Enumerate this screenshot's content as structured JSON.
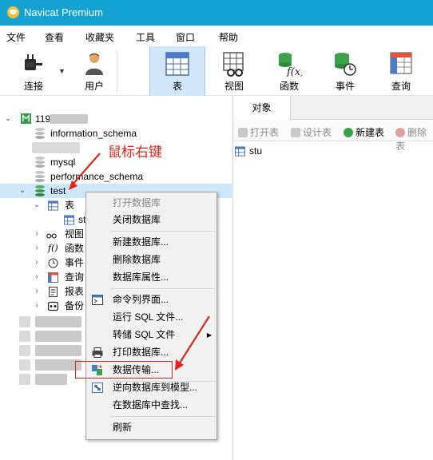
{
  "window": {
    "title": "Navicat Premium"
  },
  "menu": [
    "文件",
    "查看",
    "收藏夹",
    "工具",
    "窗口",
    "帮助"
  ],
  "toolbar": {
    "connect": "连接",
    "user": "用户",
    "table": "表",
    "view": "视图",
    "function": "函数",
    "event": "事件",
    "query": "查询"
  },
  "tree": {
    "connection": "119.",
    "dbs": [
      "information_schema",
      "mysql",
      "performance_schema",
      "test"
    ],
    "test_children": {
      "table_group": "表",
      "table_item": "st",
      "view_group": "视图",
      "function_group": "函数",
      "event_group": "事件",
      "query_group": "查询",
      "report_group": "报表",
      "backup_group": "备份"
    }
  },
  "right": {
    "tab": "对象",
    "actions": [
      "打开表",
      "设计表",
      "新建表",
      "删除表"
    ],
    "objects": [
      "stu"
    ]
  },
  "context_menu": {
    "items": [
      {
        "label": "打开数据库",
        "enabled": false
      },
      {
        "label": "关闭数据库",
        "enabled": true
      },
      {
        "label": "新建数据库...",
        "enabled": true
      },
      {
        "label": "删除数据库",
        "enabled": true
      },
      {
        "label": "数据库属性...",
        "enabled": true
      },
      {
        "label": "命令列界面...",
        "enabled": true
      },
      {
        "label": "运行 SQL 文件...",
        "enabled": true
      },
      {
        "label": "转储 SQL 文件",
        "enabled": true
      },
      {
        "label": "打印数据库...",
        "enabled": true
      },
      {
        "label": "数据传输...",
        "enabled": true
      },
      {
        "label": "逆向数据库到模型...",
        "enabled": true
      },
      {
        "label": "在数据库中查找...",
        "enabled": true
      },
      {
        "label": "刷新",
        "enabled": true
      }
    ]
  },
  "annotation": {
    "text": "鼠标右键"
  },
  "colors": {
    "titlebar": "#13a2d2",
    "selection": "#cde8fb",
    "annotation": "#e2231a"
  }
}
